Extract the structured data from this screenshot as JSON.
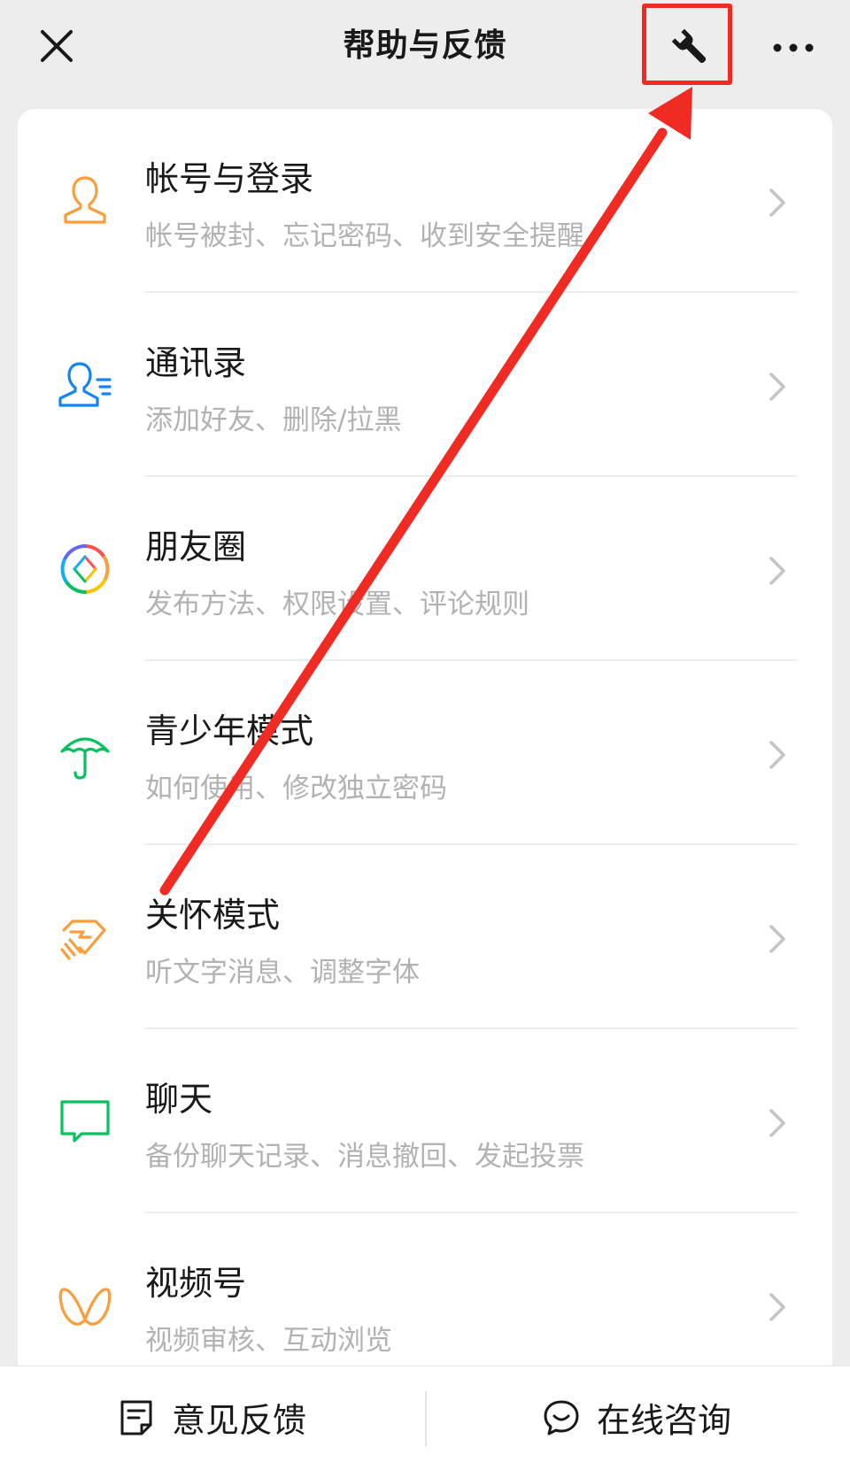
{
  "header": {
    "title": "帮助与反馈",
    "close_icon": "close-icon",
    "tool_icon": "wrench-icon",
    "more_icon": "more-icon"
  },
  "menu_items": [
    {
      "title": "帐号与登录",
      "subtitle": "帐号被封、忘记密码、收到安全提醒",
      "icon": "person-icon",
      "color": "#fa9d3b"
    },
    {
      "title": "通讯录",
      "subtitle": "添加好友、删除/拉黑",
      "icon": "contacts-icon",
      "color": "#1485ee"
    },
    {
      "title": "朋友圈",
      "subtitle": "发布方法、权限设置、评论规则",
      "icon": "moments-aperture-icon",
      "color": "multicolor"
    },
    {
      "title": "青少年模式",
      "subtitle": "如何使用、修改独立密码",
      "icon": "umbrella-icon",
      "color": "#07c160"
    },
    {
      "title": "关怀模式",
      "subtitle": "听文字消息、调整字体",
      "icon": "care-heart-hand-icon",
      "color": "#fa9d3b"
    },
    {
      "title": "聊天",
      "subtitle": "备份聊天记录、消息撤回、发起投票",
      "icon": "chat-bubble-icon",
      "color": "#07c160"
    },
    {
      "title": "视频号",
      "subtitle": "视频审核、互动浏览",
      "icon": "channels-butterfly-icon",
      "color": "#fa9d3b"
    }
  ],
  "bottom_bar": {
    "feedback_label": "意见反馈",
    "consult_label": "在线咨询"
  },
  "annotation": {
    "highlight_color": "#f02b23"
  }
}
